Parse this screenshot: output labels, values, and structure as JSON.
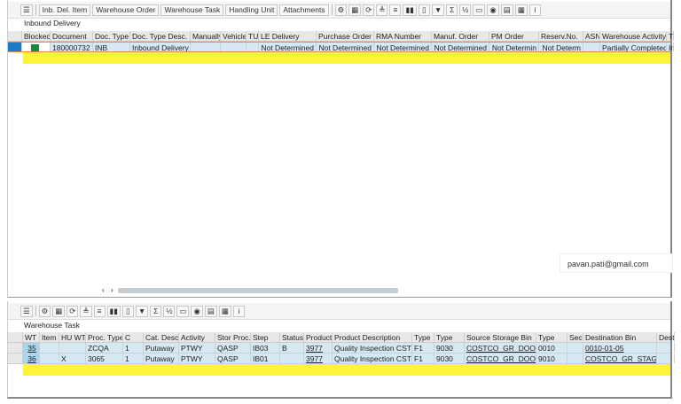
{
  "top": {
    "tabs": [
      "Inb. Del. Item",
      "Warehouse Order",
      "Warehouse Task",
      "Handling Unit",
      "Attachments"
    ],
    "title": "Inbound Delivery",
    "columns": [
      "",
      "Blocked",
      "Document",
      "Doc. Type",
      "Doc. Type Desc.",
      "Manually",
      "Vehicle",
      "TU",
      "LE Delivery",
      "Purchase Order",
      "RMA Number",
      "Manuf. Order",
      "PM Order",
      "Reserv.No.",
      "ASN",
      "Warehouse Activity",
      "T"
    ],
    "rows": [
      [
        "",
        "",
        "180000732",
        "INB",
        "Inbound Delivery",
        "",
        "",
        "",
        "Not Determined",
        "Not Determined",
        "Not Determined",
        "Not Determined",
        "Not Determin",
        "Not Determ",
        "",
        "Partially Completed",
        "In"
      ]
    ],
    "blocked_status_color": "#1a8a3a"
  },
  "bottom": {
    "title": "Warehouse Task",
    "columns": [
      "",
      "WT",
      "Item",
      "HU WT",
      "Proc. Type",
      "C",
      "Cat. Desc.",
      "Activity",
      "Stor Proc.",
      "Step",
      "Status",
      "Product",
      "Product Description",
      "Type",
      "Type",
      "Source Storage Bin",
      "Type",
      "Sec.",
      "Destination Bin",
      "Dest"
    ],
    "rows": [
      [
        "",
        "35",
        "",
        "",
        "ZCQA",
        "1",
        "Putaway",
        "PTWY",
        "QASP",
        "IB03",
        "B",
        "3977",
        "Quality Inspection CST",
        "F1",
        "9030",
        "COSTCO_GR_DOOR",
        "0010",
        "",
        "0010-01-05",
        ""
      ],
      [
        "",
        "36",
        "",
        "X",
        "3065",
        "1",
        "Putaway",
        "PTWY",
        "QASP",
        "IB01",
        "",
        "3977",
        "Quality Inspection CST",
        "F1",
        "9030",
        "COSTCO_GR_DOOR",
        "9010",
        "",
        "COSTCO_GR_STAGE",
        ""
      ]
    ]
  },
  "watermark": "pavan.pati@gmail.com",
  "colors": {
    "selection": "#d6e8f2",
    "highlight_row": "#fef33a",
    "row_marker": "#1a7bc4"
  }
}
